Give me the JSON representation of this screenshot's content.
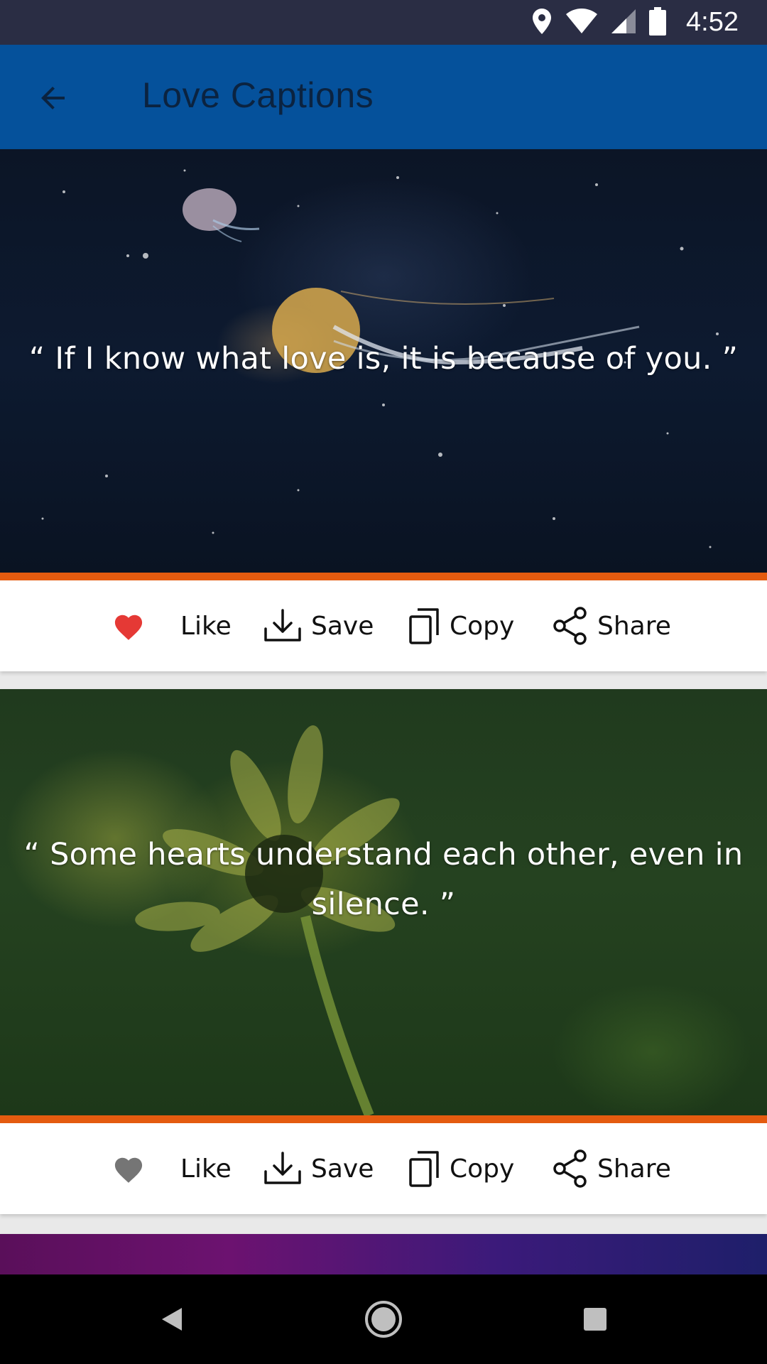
{
  "status_bar": {
    "time": "4:52",
    "icons": [
      "location-icon",
      "wifi-icon",
      "signal-icon",
      "battery-icon"
    ]
  },
  "app_bar": {
    "title": "Love Captions",
    "back_icon": "arrow-back-icon"
  },
  "captions": [
    {
      "text": "“ If I know what love is, it is because of you. ”",
      "liked": true,
      "image": "jellyfish-night-sky"
    },
    {
      "text": "“ Some hearts understand each other, even in silence. ”",
      "liked": false,
      "image": "green-flower"
    }
  ],
  "actions": {
    "like": "Like",
    "save": "Save",
    "copy": "Copy",
    "share": "Share"
  },
  "colors": {
    "status_bar": "#2a2d44",
    "app_bar": "#05519b",
    "accent_divider": "#e45b0f",
    "liked_heart": "#e53935",
    "unliked_heart": "#757575"
  },
  "nav_bar": {
    "buttons": [
      "back-triangle-icon",
      "home-circle-icon",
      "recents-square-icon"
    ]
  }
}
